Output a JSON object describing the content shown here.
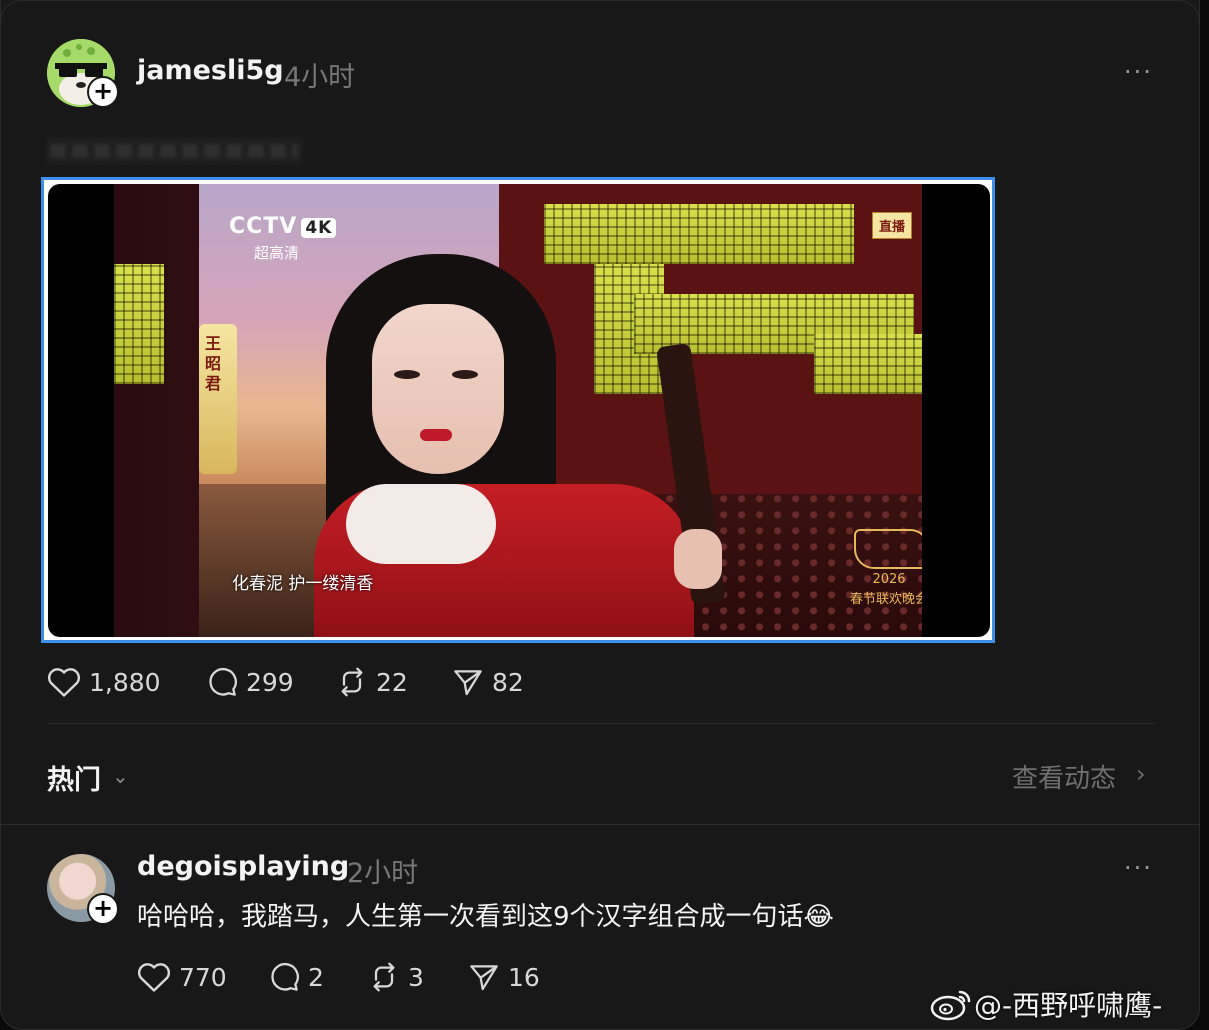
{
  "post": {
    "username": "jamesli5g",
    "time": "4小时",
    "more_label": "···",
    "stats": {
      "likes": "1,880",
      "comments": "299",
      "reposts": "22",
      "shares": "82"
    },
    "video": {
      "channel_logo": "CCTV",
      "channel_quality": "4K",
      "quality_label": "超高清",
      "live_badge": "直播",
      "scroll_text": "王昭君",
      "subtitle": "化春泥 护一缕清香",
      "event_year": "2026",
      "event_name": "春节联欢晚会"
    }
  },
  "section": {
    "hot_label": "热门",
    "view_activity": "查看动态"
  },
  "comment": {
    "username": "degoisplaying",
    "time": "2小时",
    "more_label": "···",
    "text": "哈哈哈，我踏马，人生第一次看到这9个汉字组合成一句话",
    "emoji": "😂",
    "stats": {
      "likes": "770",
      "comments": "2",
      "reposts": "3",
      "shares": "16"
    }
  },
  "watermark": {
    "text": "@-西野呼啸鹰-"
  },
  "icons": {
    "heart": "heart-icon",
    "comment": "comment-icon",
    "repost": "repost-icon",
    "share": "share-icon",
    "plus": "plus-icon"
  },
  "colors": {
    "background": "#181818",
    "accent_border": "#3d8fe8",
    "muted_text": "#777777"
  }
}
